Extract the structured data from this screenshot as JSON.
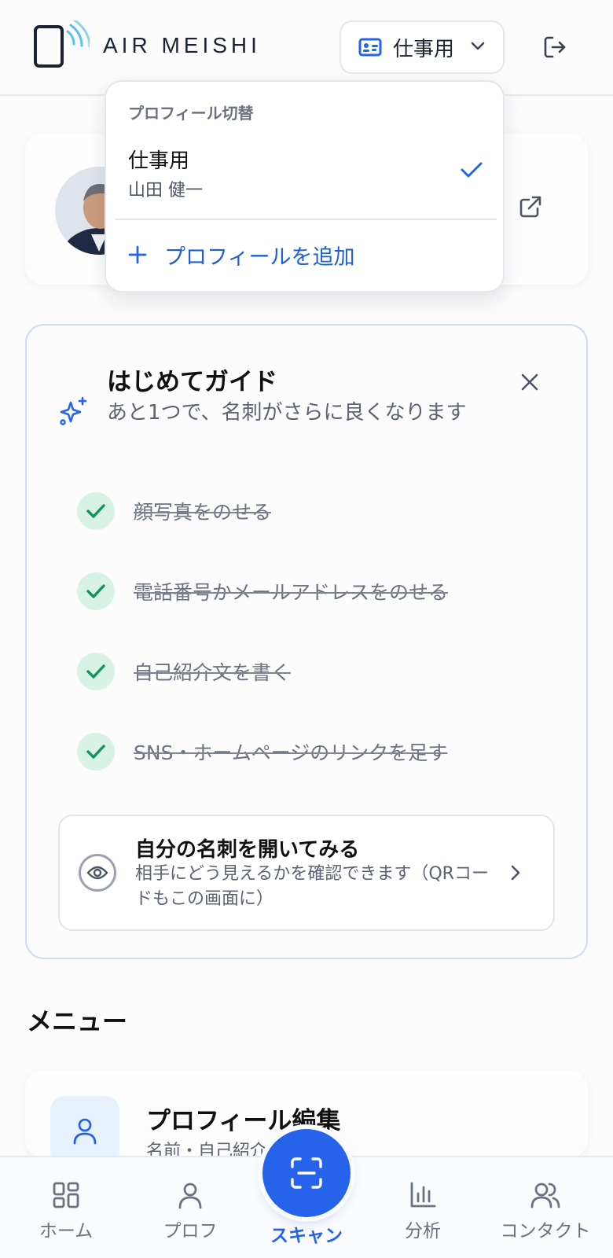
{
  "app": {
    "brand": "AIR MEISHI",
    "profile_selector_label": "仕事用"
  },
  "profile_dropdown": {
    "title": "プロフィール切替",
    "items": [
      {
        "name": "仕事用",
        "owner": "山田 健一",
        "selected": true
      }
    ],
    "add_label": "プロフィールを追加"
  },
  "guide": {
    "title": "はじめてガイド",
    "subtitle": "あと1つで、名刺がさらに良くなります",
    "tasks": [
      {
        "label": "顔写真をのせる",
        "done": true
      },
      {
        "label": "電話番号かメールアドレスをのせる",
        "done": true
      },
      {
        "label": "自己紹介文を書く",
        "done": true
      },
      {
        "label": "SNS・ホームページのリンクを足す",
        "done": true
      }
    ],
    "open_card": {
      "title": "自分の名刺を開いてみる",
      "subtitle": "相手にどう見えるかを確認できます（QRコードもこの画面に）"
    }
  },
  "menu": {
    "heading": "メニュー",
    "items": [
      {
        "title": "プロフィール編集",
        "subtitle": "名前・自己紹介…"
      }
    ]
  },
  "bottom_nav": {
    "items": [
      {
        "label": "ホーム",
        "icon": "grid-icon"
      },
      {
        "label": "プロフ",
        "icon": "person-icon"
      },
      {
        "label": "スキャン",
        "icon": "scan-icon",
        "active": true
      },
      {
        "label": "分析",
        "icon": "bar-chart-icon"
      },
      {
        "label": "コンタクト",
        "icon": "contacts-icon"
      }
    ]
  },
  "colors": {
    "accent": "#2563eb",
    "success": "#15935b",
    "success_bg": "#d8f3e6",
    "guide_border": "#cfdcf0"
  }
}
